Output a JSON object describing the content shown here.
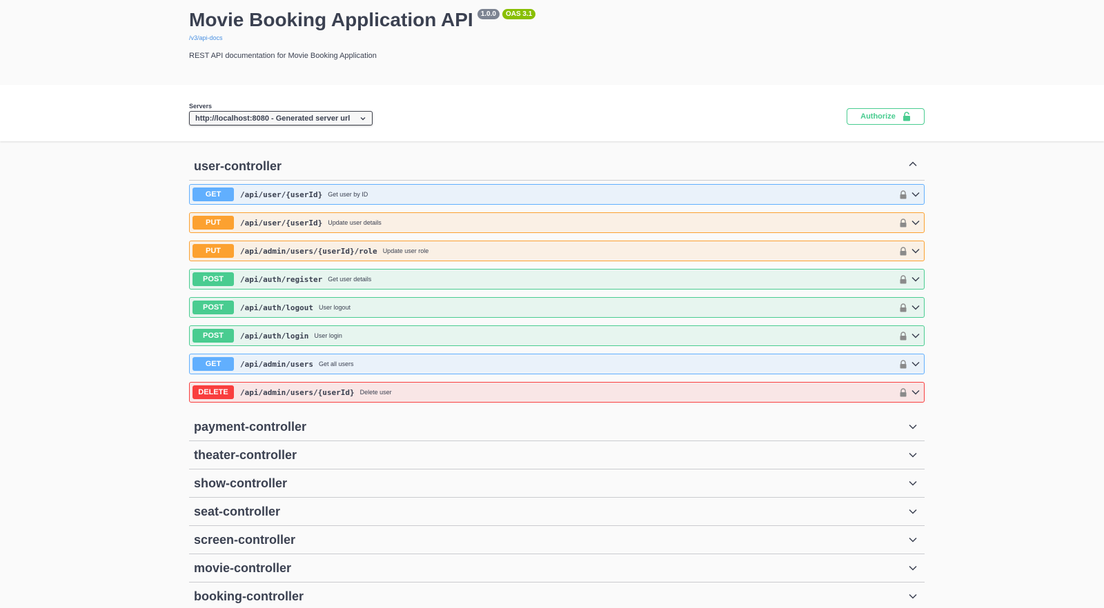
{
  "info": {
    "title": "Movie Booking Application API",
    "version_badge": "1.0.0",
    "oas_badge": "OAS 3.1",
    "docs_link": "/v3/api-docs",
    "description": "REST API documentation for Movie Booking Application"
  },
  "scheme": {
    "servers_label": "Servers",
    "selected_server": "http://localhost:8080 - Generated server url",
    "authorize_label": "Authorize"
  },
  "tags": [
    {
      "name": "user-controller",
      "expanded": true,
      "operations": [
        {
          "method": "GET",
          "path": "/api/user/{userId}",
          "summary": "Get user by ID"
        },
        {
          "method": "PUT",
          "path": "/api/user/{userId}",
          "summary": "Update user details"
        },
        {
          "method": "PUT",
          "path": "/api/admin/users/{userId}/role",
          "summary": "Update user role"
        },
        {
          "method": "POST",
          "path": "/api/auth/register",
          "summary": "Get user details"
        },
        {
          "method": "POST",
          "path": "/api/auth/logout",
          "summary": "User logout"
        },
        {
          "method": "POST",
          "path": "/api/auth/login",
          "summary": "User login"
        },
        {
          "method": "GET",
          "path": "/api/admin/users",
          "summary": "Get all users"
        },
        {
          "method": "DELETE",
          "path": "/api/admin/users/{userId}",
          "summary": "Delete user"
        }
      ]
    },
    {
      "name": "payment-controller",
      "expanded": false
    },
    {
      "name": "theater-controller",
      "expanded": false
    },
    {
      "name": "show-controller",
      "expanded": false
    },
    {
      "name": "seat-controller",
      "expanded": false
    },
    {
      "name": "screen-controller",
      "expanded": false
    },
    {
      "name": "movie-controller",
      "expanded": false
    },
    {
      "name": "booking-controller",
      "expanded": false
    }
  ],
  "colors": {
    "get": "#61affe",
    "put": "#fca130",
    "post": "#49cc90",
    "delete": "#f93e3e",
    "oas_badge": "#89bf04",
    "version_badge": "#7d8492"
  }
}
